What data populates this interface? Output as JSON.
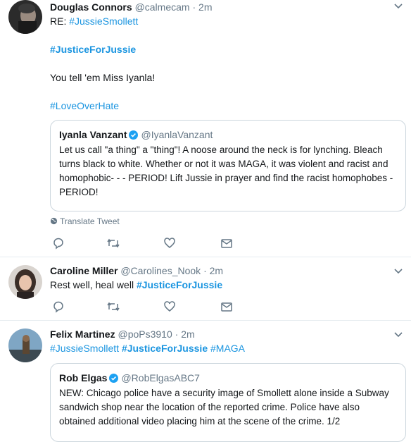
{
  "tweets": [
    {
      "name": "Douglas Connors",
      "handle": "@calmecam",
      "sep": "·",
      "time": "2m",
      "re_prefix": "RE: ",
      "re_tag": "#JussieSmollett",
      "tag1": "#JusticeForJussie",
      "body": "You tell 'em Miss Iyanla!",
      "tag2": "#LoveOverHate",
      "quote": {
        "name": "Iyanla Vanzant",
        "handle": "@IyanlaVanzant",
        "text": "Let us call \"a thing\" a \"thing\"! A noose around the neck is for lynching. Bleach turns black to white. Whether or not it was MAGA, it was violent and racist and homophobic- - - PERIOD! Lift Jussie in prayer and find the racist homophobes -PERIOD!"
      },
      "translate": "Translate Tweet"
    },
    {
      "name": "Caroline Miller",
      "handle": "@Carolines_Nook",
      "sep": "·",
      "time": "2m",
      "body": "Rest well, heal well ",
      "tag": "#JusticeForJussie"
    },
    {
      "name": "Felix Martinez",
      "handle": "@poPs3910",
      "sep": "·",
      "time": "2m",
      "tag_a": "#JussieSmollett",
      "tag_b": "#JusticeForJussie",
      "tag_c": "#MAGA",
      "quote": {
        "name": "Rob Elgas",
        "handle": "@RobElgasABC7",
        "text": "NEW: Chicago police have a security image of Smollett alone inside a Subway sandwich shop near the location of the reported crime. Police have also obtained additional video placing him at the scene of the crime. 1/2"
      }
    }
  ],
  "icons": {
    "reply": "reply-icon",
    "retweet": "retweet-icon",
    "like": "heart-icon",
    "dm": "envelope-icon",
    "chevron": "chevron-down-icon",
    "globe": "globe-icon",
    "verified": "verified-badge-icon"
  },
  "colors": {
    "link": "#1b95e0",
    "muted": "#657786",
    "border": "#e6ecf0",
    "verified": "#1da1f2"
  }
}
